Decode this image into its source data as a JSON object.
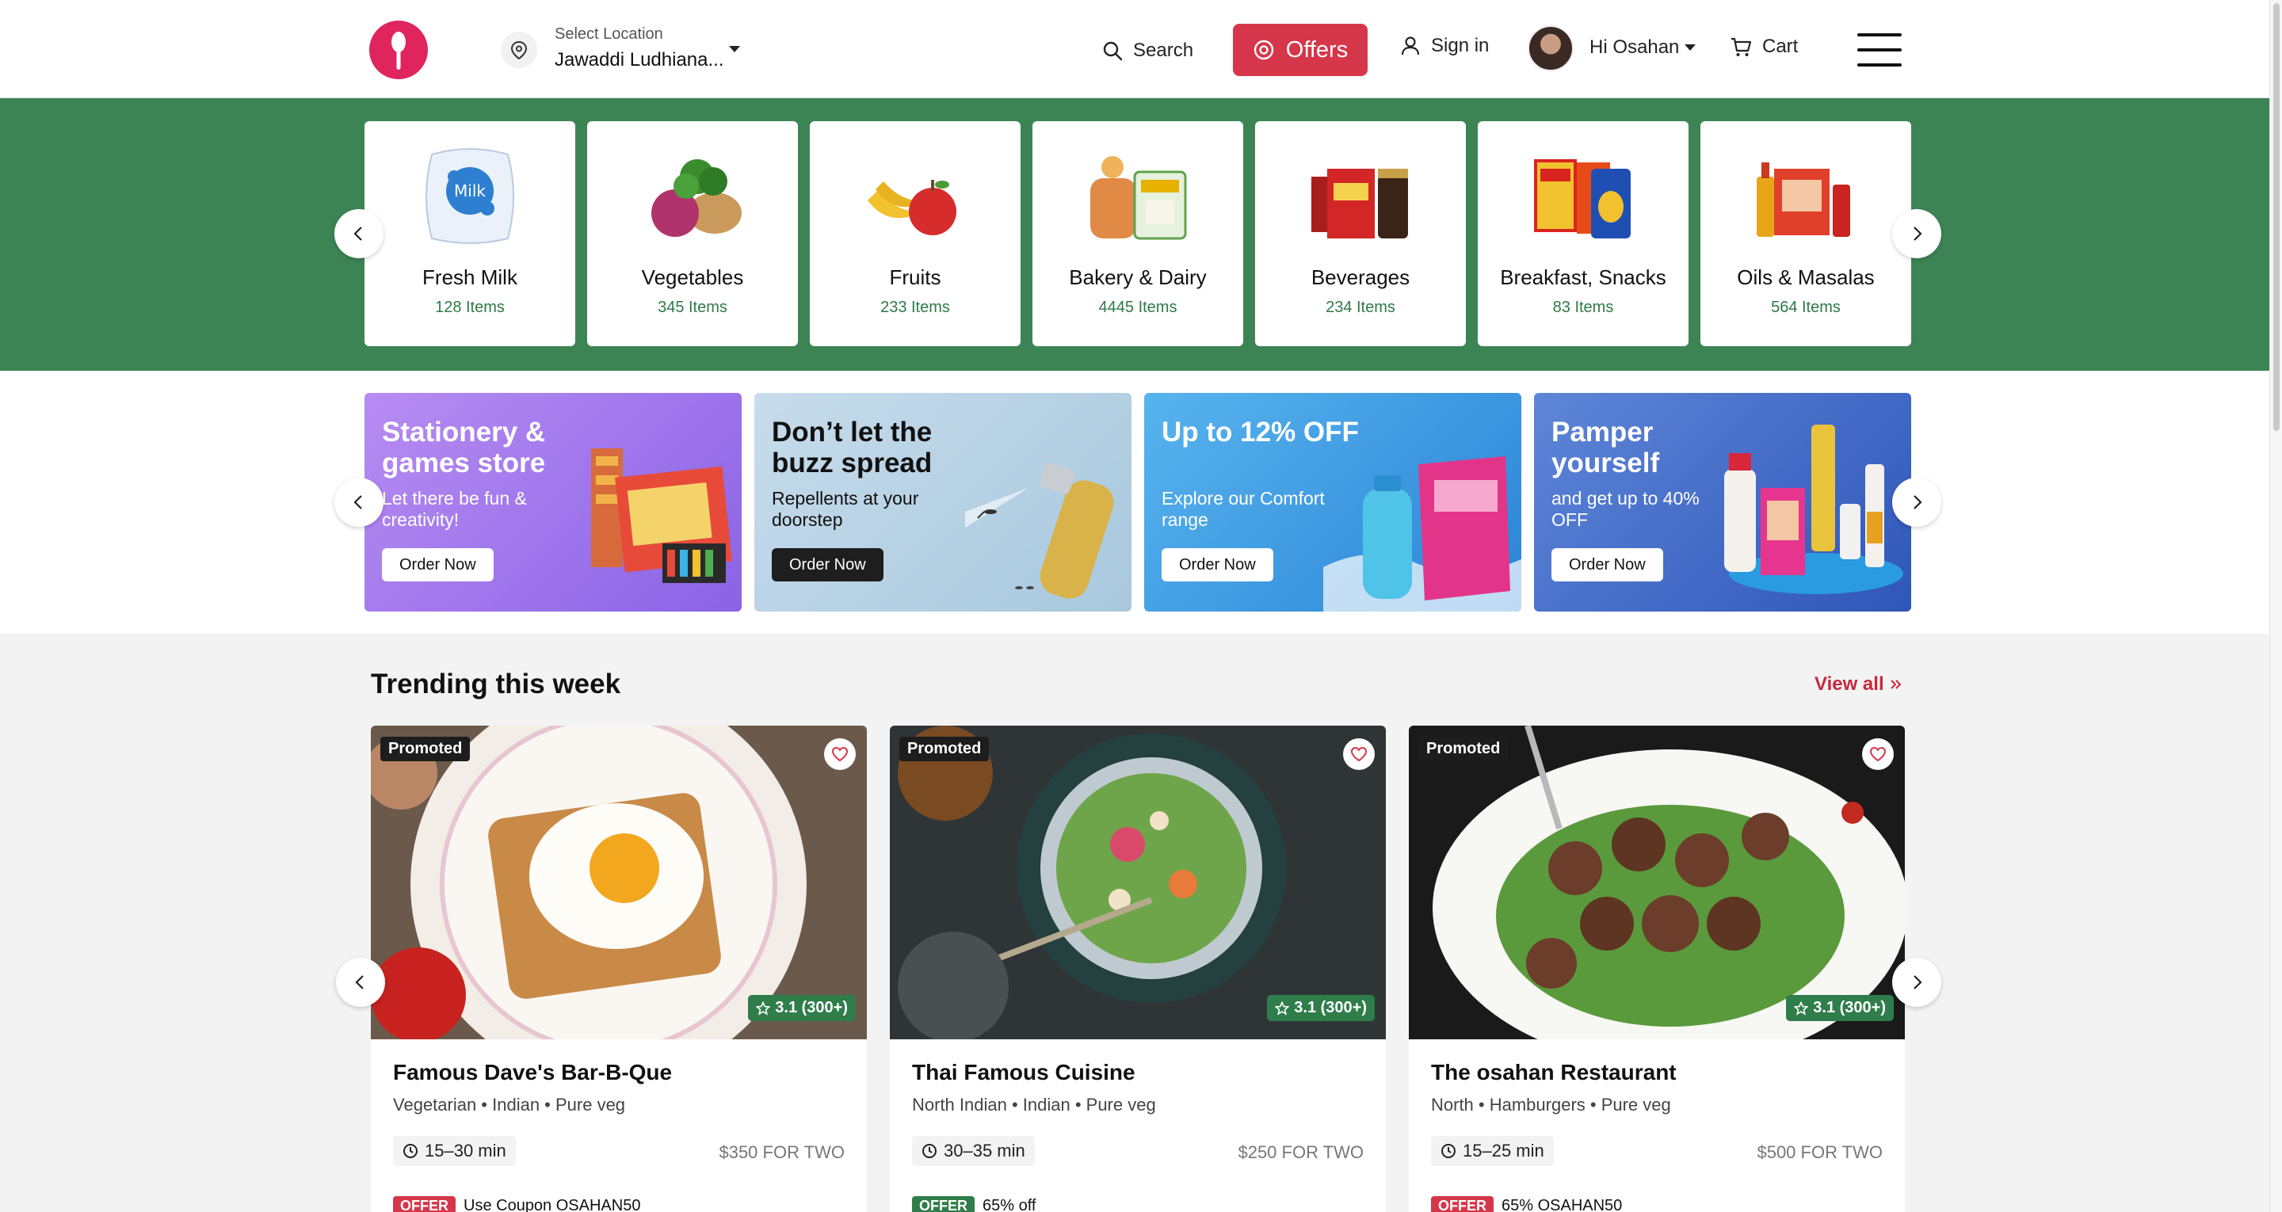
{
  "header": {
    "logo_icon": "spoon-logo-icon",
    "location_label": "Select Location",
    "location_value": "Jawaddi Ludhiana...",
    "search_label": "Search",
    "offers_label": "Offers",
    "signin_label": "Sign in",
    "user_greeting": "Hi Osahan",
    "cart_label": "Cart",
    "brand_color": "#e0245e",
    "offers_color": "#d6364a"
  },
  "categories": {
    "background_color": "#3d8455",
    "items": [
      {
        "name": "Fresh Milk",
        "count": "128 Items"
      },
      {
        "name": "Vegetables",
        "count": "345 Items"
      },
      {
        "name": "Fruits",
        "count": "233 Items"
      },
      {
        "name": "Bakery & Dairy",
        "count": "4445 Items"
      },
      {
        "name": "Beverages",
        "count": "234 Items"
      },
      {
        "name": "Breakfast, Snacks",
        "count": "83 Items"
      },
      {
        "name": "Oils & Masalas",
        "count": "564 Items"
      }
    ]
  },
  "promos": [
    {
      "title": "Stationery & games store",
      "subtitle": "Let there be fun & creativity!",
      "button": "Order Now"
    },
    {
      "title": "Don’t let the buzz spread",
      "subtitle": "Repellents at your doorstep",
      "button": "Order Now"
    },
    {
      "title": "Up to 12% OFF",
      "subtitle": "Explore our Comfort range",
      "button": "Order Now"
    },
    {
      "title": "Pamper yourself",
      "subtitle": "and get up to 40% OFF",
      "button": "Order Now"
    }
  ],
  "trending": {
    "title": "Trending this week",
    "view_all": "View all",
    "restaurants": [
      {
        "badge": "Promoted",
        "rating": "3.1 (300+)",
        "name": "Famous Dave's Bar-B-Que",
        "cuisine": "Vegetarian • Indian • Pure veg",
        "time": "15–30 min",
        "price": "$350 FOR TWO",
        "offer_tag": "OFFER",
        "offer_text": "Use Coupon OSAHAN50"
      },
      {
        "badge": "Promoted",
        "rating": "3.1 (300+)",
        "name": "Thai Famous Cuisine",
        "cuisine": "North Indian • Indian • Pure veg",
        "time": "30–35 min",
        "price": "$250 FOR TWO",
        "offer_tag": "OFFER",
        "offer_text": "65% off"
      },
      {
        "badge": "Promoted",
        "rating": "3.1 (300+)",
        "name": "The osahan Restaurant",
        "cuisine": "North • Hamburgers • Pure veg",
        "time": "15–25 min",
        "price": "$500 FOR TWO",
        "offer_tag": "OFFER",
        "offer_text": "65% OSAHAN50"
      }
    ]
  }
}
